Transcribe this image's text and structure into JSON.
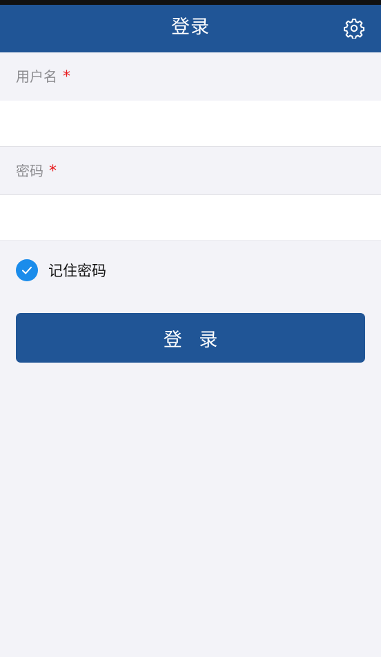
{
  "header": {
    "title": "登录",
    "settings_icon": "gear-icon"
  },
  "form": {
    "username": {
      "label": "用户名",
      "required_mark": "*",
      "value": "",
      "placeholder": ""
    },
    "password": {
      "label": "密码",
      "required_mark": "*",
      "value": "",
      "placeholder": ""
    },
    "remember": {
      "label": "记住密码",
      "checked": true,
      "icon": "check-icon"
    },
    "submit_label": "登 录"
  },
  "colors": {
    "primary": "#205596",
    "checkbox": "#1a8ceb",
    "required": "#e8191c",
    "background": "#f3f3f8"
  }
}
